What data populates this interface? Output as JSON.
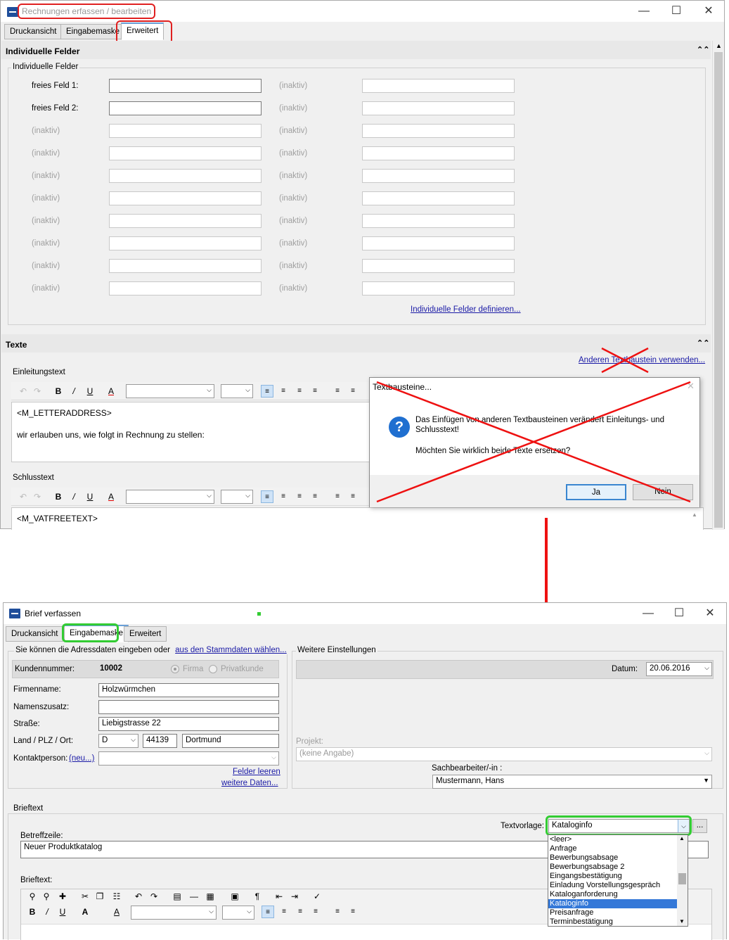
{
  "top_window": {
    "title": "Rechnungen erfassen / bearbeiten",
    "tabs": [
      "Druckansicht",
      "Eingabemaske",
      "Erweitert"
    ],
    "section_individual": "Individuelle Felder",
    "group_individual": "Individuelle Felder",
    "row_labels": [
      "freies Feld 1:",
      "freies Feld 2:",
      "(inaktiv)",
      "(inaktiv)",
      "(inaktiv)",
      "(inaktiv)",
      "(inaktiv)",
      "(inaktiv)",
      "(inaktiv)",
      "(inaktiv)"
    ],
    "inactive_label": "(inaktiv)",
    "define_link": "Individuelle Felder definieren...",
    "section_texts": "Texte",
    "other_textblock_link": "Anderen Textbaustein verwenden...",
    "intro_label": "Einleitungstext",
    "intro_lines": [
      "<M_LETTERADDRESS>",
      "wir erlauben uns, wie folgt in Rechnung zu stellen:"
    ],
    "closing_label": "Schlusstext",
    "closing_lines": [
      "<M_VATFREETEXT>"
    ]
  },
  "dialog": {
    "title": "Textbausteine...",
    "message": "Das Einfügen von anderen Textbausteinen verändert Einleitungs- und Schlusstext!",
    "question": "Möchten Sie wirklich beide Texte ersetzen?",
    "yes": "Ja",
    "no": "Nein",
    "icon": "question-icon"
  },
  "bottom_window": {
    "title": "Brief verfassen",
    "tabs": [
      "Druckansicht",
      "Eingabemaske",
      "Erweitert"
    ],
    "address_hint": "Sie können die Adressdaten eingeben oder",
    "address_link": "aus den Stammdaten wählen...",
    "customer_label": "Kundennummer:",
    "customer_no": "10002",
    "radio_company": "Firma",
    "radio_private": "Privatkunde",
    "company_label": "Firmenname:",
    "company_value": "Holzwürmchen",
    "suffix_label": "Namenszusatz:",
    "suffix_value": "",
    "street_label": "Straße:",
    "street_value": "Liebigstrasse 22",
    "country_label": "Land / PLZ / Ort:",
    "country_value": "D",
    "zip_value": "44139",
    "city_value": "Dortmund",
    "contact_label": "Kontaktperson:",
    "contact_link": "(neu...)",
    "clear_link": "Felder leeren",
    "more_link": "weitere Daten...",
    "settings_label": "Weitere Einstellungen",
    "date_label": "Datum:",
    "date_value": "20.06.2016",
    "project_label": "Projekt:",
    "project_value": "(keine Angabe)",
    "clerk_label": "Sachbearbeiter/-in :",
    "clerk_value": "Mustermann, Hans",
    "brieftext_group": "Brieftext",
    "template_label": "Textvorlage:",
    "template_value": "Kataloginfo",
    "subject_label": "Betreffzeile:",
    "subject_value": "Neuer Produktkatalog",
    "body_label": "Brieftext:",
    "template_options": [
      "<leer>",
      "Anfrage",
      "Bewerbungsabsage",
      "Bewerbungsabsage 2",
      "Eingangsbestätigung",
      "Einladung Vorstellungsgespräch",
      "Kataloganforderung",
      "Kataloginfo",
      "Preisanfrage",
      "Terminbestätigung"
    ],
    "selected_option": "Kataloginfo",
    "ellipsis_button": "..."
  },
  "annotations": {
    "highlight_red": "#e02020",
    "highlight_green": "#33cc33",
    "arrow_color": "#ee1111"
  }
}
